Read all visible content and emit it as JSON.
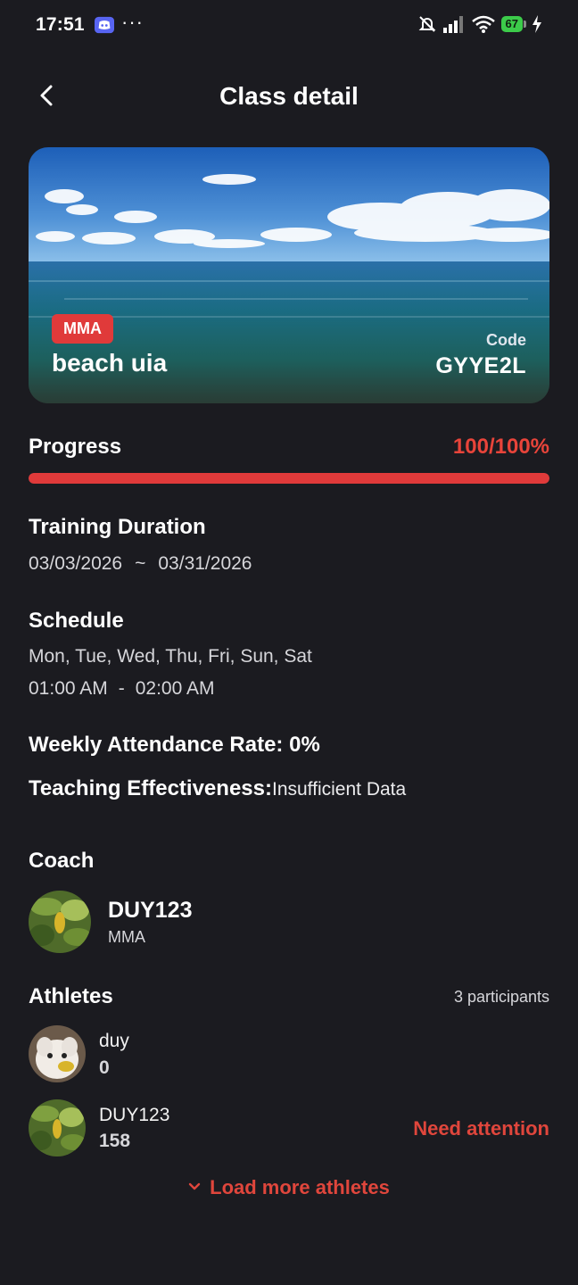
{
  "status_bar": {
    "time": "17:51",
    "dots": "···",
    "battery": "67"
  },
  "header": {
    "title": "Class detail"
  },
  "class": {
    "sport_badge": "MMA",
    "name": "beach uia",
    "code_label": "Code",
    "code": "GYYE2L"
  },
  "progress": {
    "label": "Progress",
    "value_text": "100/100%",
    "fraction": 1.0
  },
  "training_duration": {
    "label": "Training Duration",
    "start": "03/03/2026",
    "separator": "~",
    "end": "03/31/2026"
  },
  "schedule": {
    "label": "Schedule",
    "days": "Mon, Tue, Wed, Thu, Fri, Sun, Sat",
    "start_time": "01:00 AM",
    "separator": "-",
    "end_time": "02:00 AM"
  },
  "weekly_attendance": "Weekly Attendance Rate: 0%",
  "teaching": {
    "label": "Teaching Effectiveness:",
    "value": "Insufficient Data"
  },
  "coach": {
    "label": "Coach",
    "name": "DUY123",
    "sport": "MMA"
  },
  "athletes": {
    "label": "Athletes",
    "count_text": "3 participants",
    "items": [
      {
        "name": "duy",
        "value": "0",
        "status": ""
      },
      {
        "name": "DUY123",
        "value": "158",
        "status": "Need attention"
      }
    ],
    "load_more": "Load more athletes"
  },
  "colors": {
    "accent": "#e03a3a",
    "background": "#1b1b20"
  },
  "icons": [
    "discord-icon",
    "mute-icon",
    "signal-icon",
    "wifi-icon",
    "battery-icon",
    "charging-icon",
    "back-arrow-icon",
    "chevron-down-icon"
  ]
}
